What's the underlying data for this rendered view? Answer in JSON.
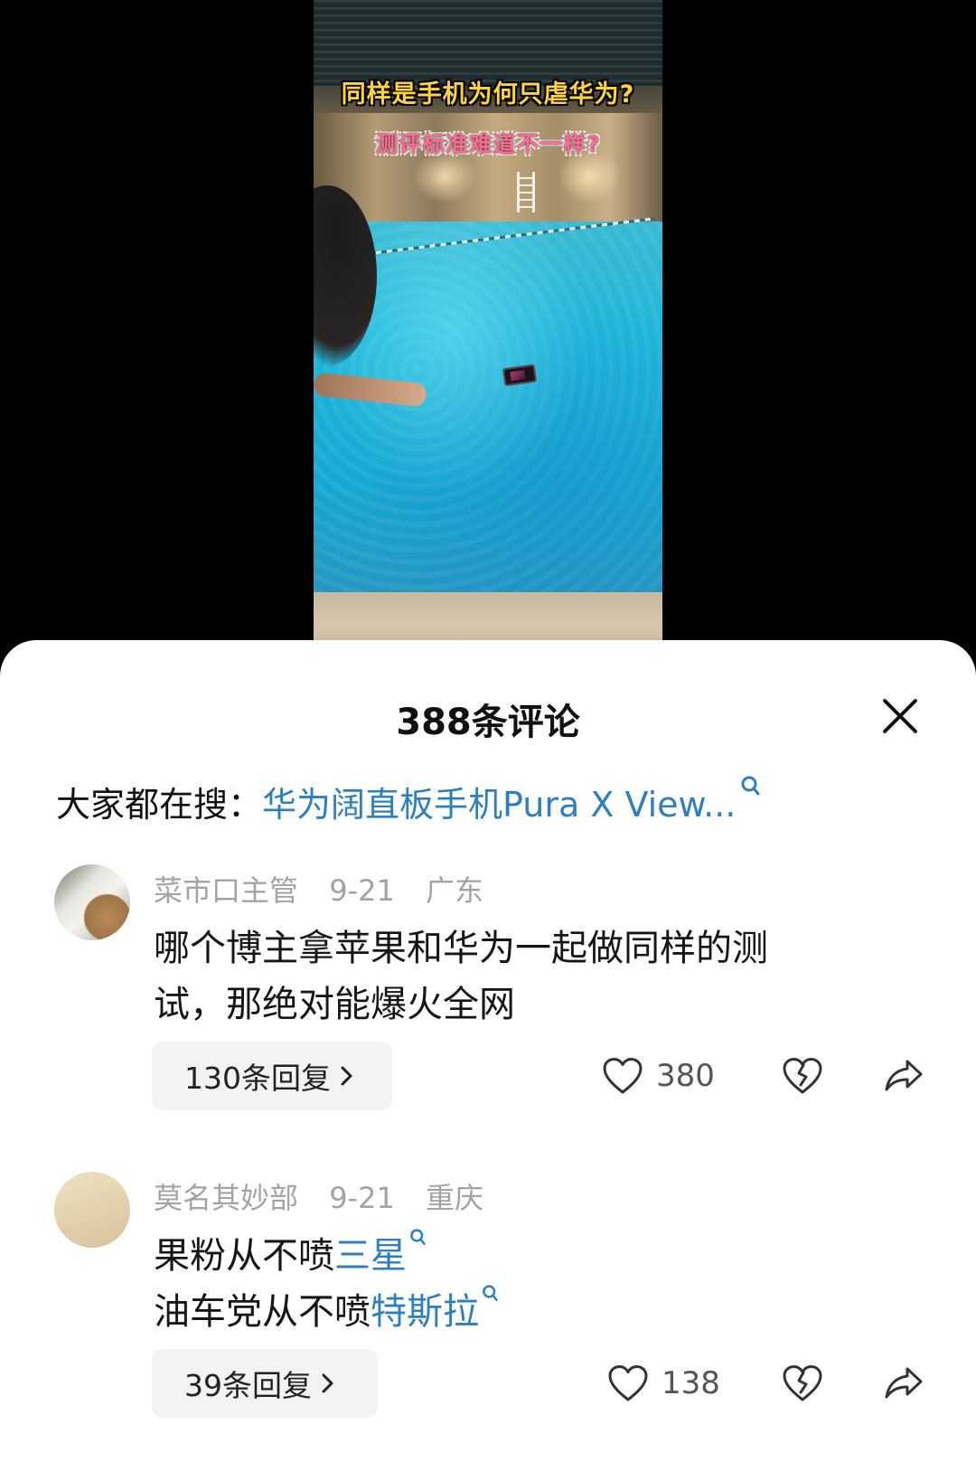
{
  "video": {
    "overlay_line1": "同样是手机为何只虐华为?",
    "overlay_line2": "测评标准难道不一样?"
  },
  "sheet": {
    "title": "388条评论",
    "close_icon": "close-icon"
  },
  "search": {
    "prefix": "大家都在搜：",
    "query": "华为阔直板手机Pura X View...",
    "icon": "search-icon"
  },
  "comments": [
    {
      "username": "菜市口主管",
      "date": "9-21",
      "location": "广东",
      "lines": [
        {
          "text": "哪个博主拿苹果和华为一起做同样的测"
        },
        {
          "text": "试，那绝对能爆火全网"
        }
      ],
      "replies_label": "130条回复",
      "likes": "380"
    },
    {
      "username": "莫名其妙部",
      "date": "9-21",
      "location": "重庆",
      "lines": [
        {
          "text": "果粉从不喷",
          "link": "三星"
        },
        {
          "text": "油车党从不喷",
          "link": "特斯拉"
        }
      ],
      "replies_label": "39条回复",
      "likes": "138"
    }
  ],
  "colors": {
    "link": "#2e7fc0",
    "meta": "#a3a3a3",
    "overlay_yellow": "#ffd43b",
    "overlay_pink": "#ff6a8a"
  }
}
